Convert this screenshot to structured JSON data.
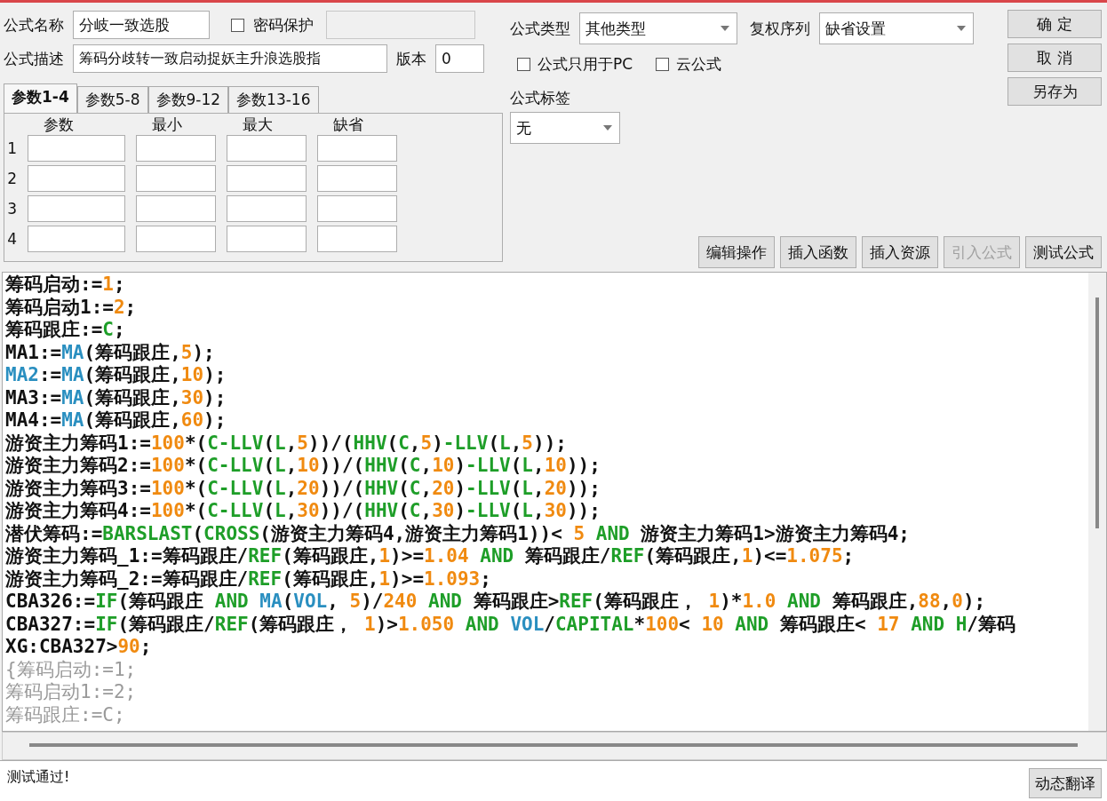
{
  "form": {
    "name_label": "公式名称",
    "name_value": "分岐一致选股",
    "password": {
      "label": "密码保护",
      "checked": false
    },
    "desc_label": "公式描述",
    "desc_value": "筹码分歧转一致启动捉妖主升浪选股指",
    "version_label": "版本",
    "version_value": "0",
    "type_label": "公式类型",
    "type_value": "其他类型",
    "rights_label": "复权序列",
    "rights_value": "缺省设置",
    "options": [
      {
        "label": "公式只用于PC",
        "checked": false
      },
      {
        "label": "云公式",
        "checked": false
      }
    ],
    "tag_label": "公式标签",
    "tag_value": "无"
  },
  "tabs": [
    {
      "label": "参数1-4",
      "selected": true
    },
    {
      "label": "参数5-8",
      "selected": false
    },
    {
      "label": "参数9-12",
      "selected": false
    },
    {
      "label": "参数13-16",
      "selected": false
    }
  ],
  "param_table": {
    "columns": [
      "参数",
      "最小",
      "最大",
      "缺省"
    ],
    "rows": [
      "1",
      "2",
      "3",
      "4"
    ]
  },
  "side_buttons": [
    "确 定",
    "取 消",
    "另存为"
  ],
  "action_buttons": [
    {
      "label": "编辑操作",
      "disabled": false
    },
    {
      "label": "插入函数",
      "disabled": false
    },
    {
      "label": "插入资源",
      "disabled": false
    },
    {
      "label": "引入公式",
      "disabled": true
    },
    {
      "label": "测试公式",
      "disabled": false
    }
  ],
  "code_lines": [
    [
      {
        "kind": "text",
        "text": "筹码启动:="
      },
      {
        "kind": "number",
        "text": "1"
      },
      {
        "kind": "text",
        "text": ";"
      }
    ],
    [
      {
        "kind": "text",
        "text": "筹码启动1:="
      },
      {
        "kind": "number",
        "text": "2"
      },
      {
        "kind": "text",
        "text": ";"
      }
    ],
    [
      {
        "kind": "text",
        "text": "筹码跟庄:="
      },
      {
        "kind": "function",
        "text": "C"
      },
      {
        "kind": "text",
        "text": ";"
      }
    ],
    [
      {
        "kind": "text",
        "text": "MA1:="
      },
      {
        "kind": "builtin",
        "text": "MA"
      },
      {
        "kind": "text",
        "text": "(筹码跟庄,"
      },
      {
        "kind": "number",
        "text": "5"
      },
      {
        "kind": "text",
        "text": ");"
      }
    ],
    [
      {
        "kind": "builtin",
        "text": "MA2"
      },
      {
        "kind": "text",
        "text": ":="
      },
      {
        "kind": "builtin",
        "text": "MA"
      },
      {
        "kind": "text",
        "text": "(筹码跟庄,"
      },
      {
        "kind": "number",
        "text": "10"
      },
      {
        "kind": "text",
        "text": ");"
      }
    ],
    [
      {
        "kind": "text",
        "text": "MA3:="
      },
      {
        "kind": "builtin",
        "text": "MA"
      },
      {
        "kind": "text",
        "text": "(筹码跟庄,"
      },
      {
        "kind": "number",
        "text": "30"
      },
      {
        "kind": "text",
        "text": ");"
      }
    ],
    [
      {
        "kind": "text",
        "text": "MA4:="
      },
      {
        "kind": "builtin",
        "text": "MA"
      },
      {
        "kind": "text",
        "text": "(筹码跟庄,"
      },
      {
        "kind": "number",
        "text": "60"
      },
      {
        "kind": "text",
        "text": ");"
      }
    ],
    [
      {
        "kind": "text",
        "text": "游资主力筹码1:="
      },
      {
        "kind": "number",
        "text": "100"
      },
      {
        "kind": "text",
        "text": "*("
      },
      {
        "kind": "function",
        "text": "C-LLV"
      },
      {
        "kind": "text",
        "text": "("
      },
      {
        "kind": "function",
        "text": "L"
      },
      {
        "kind": "text",
        "text": ","
      },
      {
        "kind": "number",
        "text": "5"
      },
      {
        "kind": "text",
        "text": "))/("
      },
      {
        "kind": "function",
        "text": "HHV"
      },
      {
        "kind": "text",
        "text": "("
      },
      {
        "kind": "function",
        "text": "C"
      },
      {
        "kind": "text",
        "text": ","
      },
      {
        "kind": "number",
        "text": "5"
      },
      {
        "kind": "text",
        "text": ")"
      },
      {
        "kind": "function",
        "text": "-LLV"
      },
      {
        "kind": "text",
        "text": "("
      },
      {
        "kind": "function",
        "text": "L"
      },
      {
        "kind": "text",
        "text": ","
      },
      {
        "kind": "number",
        "text": "5"
      },
      {
        "kind": "text",
        "text": "));"
      }
    ],
    [
      {
        "kind": "text",
        "text": "游资主力筹码2:="
      },
      {
        "kind": "number",
        "text": "100"
      },
      {
        "kind": "text",
        "text": "*("
      },
      {
        "kind": "function",
        "text": "C-LLV"
      },
      {
        "kind": "text",
        "text": "("
      },
      {
        "kind": "function",
        "text": "L"
      },
      {
        "kind": "text",
        "text": ","
      },
      {
        "kind": "number",
        "text": "10"
      },
      {
        "kind": "text",
        "text": "))/("
      },
      {
        "kind": "function",
        "text": "HHV"
      },
      {
        "kind": "text",
        "text": "("
      },
      {
        "kind": "function",
        "text": "C"
      },
      {
        "kind": "text",
        "text": ","
      },
      {
        "kind": "number",
        "text": "10"
      },
      {
        "kind": "text",
        "text": ")"
      },
      {
        "kind": "function",
        "text": "-LLV"
      },
      {
        "kind": "text",
        "text": "("
      },
      {
        "kind": "function",
        "text": "L"
      },
      {
        "kind": "text",
        "text": ","
      },
      {
        "kind": "number",
        "text": "10"
      },
      {
        "kind": "text",
        "text": "));"
      }
    ],
    [
      {
        "kind": "text",
        "text": "游资主力筹码3:="
      },
      {
        "kind": "number",
        "text": "100"
      },
      {
        "kind": "text",
        "text": "*("
      },
      {
        "kind": "function",
        "text": "C-LLV"
      },
      {
        "kind": "text",
        "text": "("
      },
      {
        "kind": "function",
        "text": "L"
      },
      {
        "kind": "text",
        "text": ","
      },
      {
        "kind": "number",
        "text": "20"
      },
      {
        "kind": "text",
        "text": "))/("
      },
      {
        "kind": "function",
        "text": "HHV"
      },
      {
        "kind": "text",
        "text": "("
      },
      {
        "kind": "function",
        "text": "C"
      },
      {
        "kind": "text",
        "text": ","
      },
      {
        "kind": "number",
        "text": "20"
      },
      {
        "kind": "text",
        "text": ")"
      },
      {
        "kind": "function",
        "text": "-LLV"
      },
      {
        "kind": "text",
        "text": "("
      },
      {
        "kind": "function",
        "text": "L"
      },
      {
        "kind": "text",
        "text": ","
      },
      {
        "kind": "number",
        "text": "20"
      },
      {
        "kind": "text",
        "text": "));"
      }
    ],
    [
      {
        "kind": "text",
        "text": "游资主力筹码4:="
      },
      {
        "kind": "number",
        "text": "100"
      },
      {
        "kind": "text",
        "text": "*("
      },
      {
        "kind": "function",
        "text": "C-LLV"
      },
      {
        "kind": "text",
        "text": "("
      },
      {
        "kind": "function",
        "text": "L"
      },
      {
        "kind": "text",
        "text": ","
      },
      {
        "kind": "number",
        "text": "30"
      },
      {
        "kind": "text",
        "text": "))/("
      },
      {
        "kind": "function",
        "text": "HHV"
      },
      {
        "kind": "text",
        "text": "("
      },
      {
        "kind": "function",
        "text": "C"
      },
      {
        "kind": "text",
        "text": ","
      },
      {
        "kind": "number",
        "text": "30"
      },
      {
        "kind": "text",
        "text": ")"
      },
      {
        "kind": "function",
        "text": "-LLV"
      },
      {
        "kind": "text",
        "text": "("
      },
      {
        "kind": "function",
        "text": "L"
      },
      {
        "kind": "text",
        "text": ","
      },
      {
        "kind": "number",
        "text": "30"
      },
      {
        "kind": "text",
        "text": "));"
      }
    ],
    [
      {
        "kind": "text",
        "text": "潜伏筹码:="
      },
      {
        "kind": "function",
        "text": "BARSLAST"
      },
      {
        "kind": "text",
        "text": "("
      },
      {
        "kind": "function",
        "text": "CROSS"
      },
      {
        "kind": "text",
        "text": "(游资主力筹码4,游资主力筹码1))< "
      },
      {
        "kind": "number",
        "text": "5"
      },
      {
        "kind": "function",
        "text": " AND"
      },
      {
        "kind": "text",
        "text": " 游资主力筹码1>游资主力筹码4;"
      }
    ],
    [
      {
        "kind": "text",
        "text": "游资主力筹码_1:=筹码跟庄/"
      },
      {
        "kind": "function",
        "text": "REF"
      },
      {
        "kind": "text",
        "text": "(筹码跟庄,"
      },
      {
        "kind": "number",
        "text": "1"
      },
      {
        "kind": "text",
        "text": ")>="
      },
      {
        "kind": "number",
        "text": "1.04"
      },
      {
        "kind": "function",
        "text": " AND"
      },
      {
        "kind": "text",
        "text": " 筹码跟庄/"
      },
      {
        "kind": "function",
        "text": "REF"
      },
      {
        "kind": "text",
        "text": "(筹码跟庄,"
      },
      {
        "kind": "number",
        "text": "1"
      },
      {
        "kind": "text",
        "text": ")<="
      },
      {
        "kind": "number",
        "text": "1.075"
      },
      {
        "kind": "text",
        "text": ";"
      }
    ],
    [
      {
        "kind": "text",
        "text": "游资主力筹码_2:=筹码跟庄/"
      },
      {
        "kind": "function",
        "text": "REF"
      },
      {
        "kind": "text",
        "text": "(筹码跟庄,"
      },
      {
        "kind": "number",
        "text": "1"
      },
      {
        "kind": "text",
        "text": ")>="
      },
      {
        "kind": "number",
        "text": "1.093"
      },
      {
        "kind": "text",
        "text": ";"
      }
    ],
    [
      {
        "kind": "text",
        "text": "CBA326:="
      },
      {
        "kind": "function",
        "text": "IF"
      },
      {
        "kind": "text",
        "text": "(筹码跟庄 "
      },
      {
        "kind": "function",
        "text": "AND"
      },
      {
        "kind": "builtin",
        "text": " MA"
      },
      {
        "kind": "text",
        "text": "("
      },
      {
        "kind": "builtin",
        "text": "VOL"
      },
      {
        "kind": "text",
        "text": ", "
      },
      {
        "kind": "number",
        "text": "5"
      },
      {
        "kind": "text",
        "text": ")/"
      },
      {
        "kind": "number",
        "text": "240"
      },
      {
        "kind": "function",
        "text": " AND"
      },
      {
        "kind": "text",
        "text": " 筹码跟庄>"
      },
      {
        "kind": "function",
        "text": "REF"
      },
      {
        "kind": "text",
        "text": "(筹码跟庄， "
      },
      {
        "kind": "number",
        "text": "1"
      },
      {
        "kind": "text",
        "text": ")*"
      },
      {
        "kind": "number",
        "text": "1.0"
      },
      {
        "kind": "function",
        "text": " AND"
      },
      {
        "kind": "text",
        "text": " 筹码跟庄,"
      },
      {
        "kind": "number",
        "text": "88"
      },
      {
        "kind": "text",
        "text": ","
      },
      {
        "kind": "number",
        "text": "0"
      },
      {
        "kind": "text",
        "text": ");"
      }
    ],
    [
      {
        "kind": "text",
        "text": "CBA327:="
      },
      {
        "kind": "function",
        "text": "IF"
      },
      {
        "kind": "text",
        "text": "(筹码跟庄/"
      },
      {
        "kind": "function",
        "text": "REF"
      },
      {
        "kind": "text",
        "text": "(筹码跟庄， "
      },
      {
        "kind": "number",
        "text": "1"
      },
      {
        "kind": "text",
        "text": ")>"
      },
      {
        "kind": "number",
        "text": "1.050"
      },
      {
        "kind": "function",
        "text": " AND"
      },
      {
        "kind": "builtin",
        "text": " VOL"
      },
      {
        "kind": "text",
        "text": "/"
      },
      {
        "kind": "function",
        "text": "CAPITAL"
      },
      {
        "kind": "text",
        "text": "*"
      },
      {
        "kind": "number",
        "text": "100"
      },
      {
        "kind": "text",
        "text": "< "
      },
      {
        "kind": "number",
        "text": "10"
      },
      {
        "kind": "function",
        "text": " AND"
      },
      {
        "kind": "text",
        "text": " 筹码跟庄< "
      },
      {
        "kind": "number",
        "text": "17"
      },
      {
        "kind": "function",
        "text": " AND"
      },
      {
        "kind": "function",
        "text": " H"
      },
      {
        "kind": "text",
        "text": "/筹码"
      }
    ],
    [
      {
        "kind": "text",
        "text": "XG:CBA327>"
      },
      {
        "kind": "number",
        "text": "90"
      },
      {
        "kind": "text",
        "text": ";"
      }
    ],
    [
      {
        "kind": "comment",
        "text": "{筹码启动:=1;"
      }
    ],
    [
      {
        "kind": "comment",
        "text": "筹码启动1:=2;"
      }
    ],
    [
      {
        "kind": "comment",
        "text": "筹码跟庄:=C;"
      }
    ]
  ],
  "message": "测试通过!",
  "translate_button": "动态翻译"
}
